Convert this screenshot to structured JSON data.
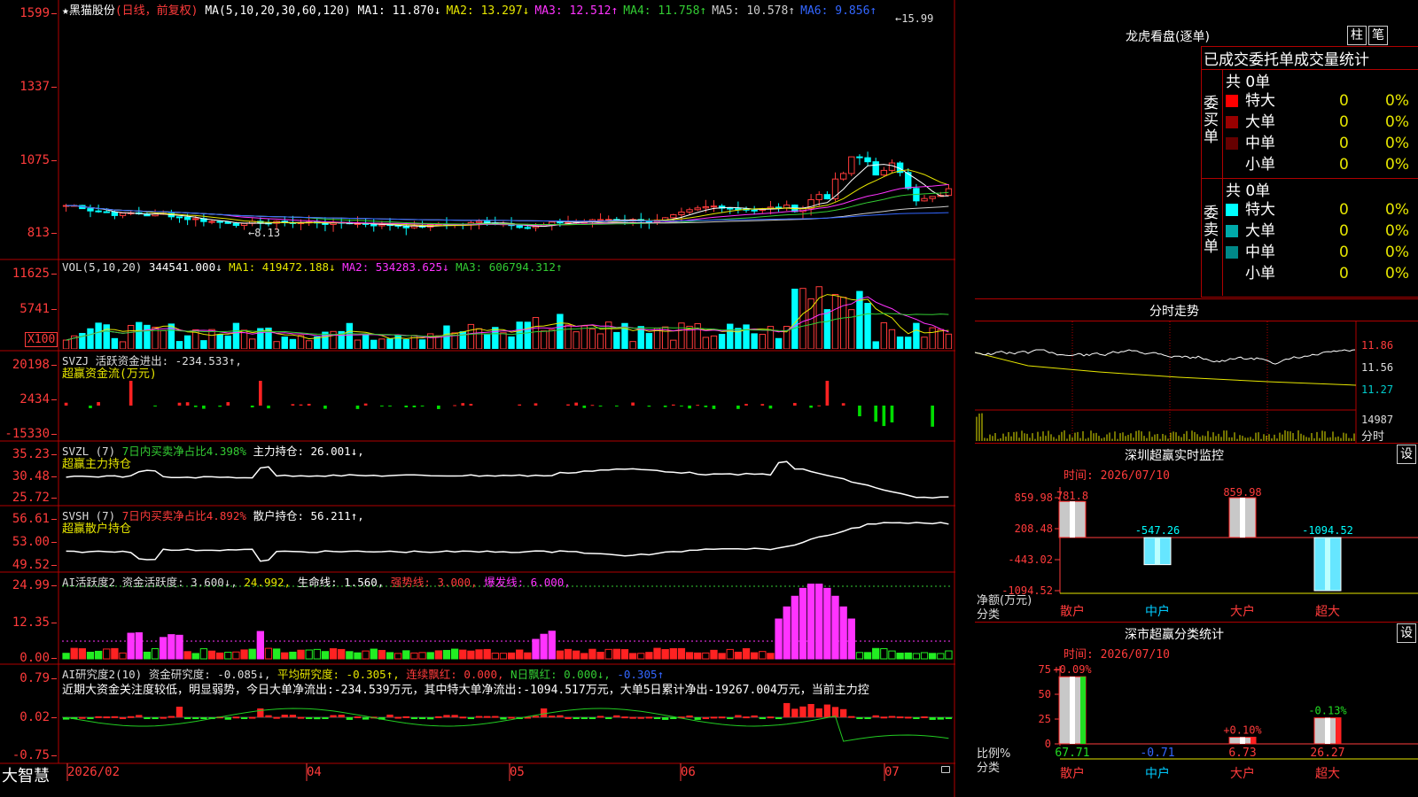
{
  "main_header": {
    "star": "★",
    "stock_name": "黑猫股份",
    "period": "(日线，前复权)",
    "ma_label": "MA(5,10,20,30,60,120)",
    "ma": [
      {
        "label": "MA1:",
        "value": "11.870↓",
        "color": "#ffffff"
      },
      {
        "label": "MA2:",
        "value": "13.297↓",
        "color": "#e6e600"
      },
      {
        "label": "MA3:",
        "value": "12.512↑",
        "color": "#ff33ff"
      },
      {
        "label": "MA4:",
        "value": "11.758↑",
        "color": "#33cc33"
      },
      {
        "label": "MA5:",
        "value": "10.578↑",
        "color": "#cccccc"
      },
      {
        "label": "MA6:",
        "value": "9.856↑",
        "color": "#3366ff"
      }
    ],
    "high_mark": "15.99",
    "low_mark": "8.13",
    "y_ticks": [
      "1599",
      "1337",
      "1075",
      "813"
    ]
  },
  "vol": {
    "header_label": "VOL(5,10,20)",
    "value": "344541.000↓",
    "ma1": "MA1: 419472.188↓",
    "ma2": "MA2: 534283.625↓",
    "ma3": "MA3: 606794.312↑",
    "y_ticks": [
      "11625",
      "5741"
    ],
    "unit": "X100"
  },
  "svzj": {
    "header": "SVZJ  活跃资金进出: -234.533↑,",
    "sub": "超赢资金流(万元)",
    "y_ticks": [
      "20198",
      "2434",
      "-15330"
    ]
  },
  "svzl": {
    "header_a": "SVZL (7)",
    "header_b": "7日内买卖净占比4.398%",
    "header_c": "主力持仓: 26.001↓,",
    "sub": "超赢主力持仓",
    "y_ticks": [
      "35.23",
      "30.48",
      "25.72"
    ]
  },
  "svsh": {
    "header_a": "SVSH (7)",
    "header_b": "7日内买卖净占比4.892%",
    "header_c": "散户持仓: 56.211↑,",
    "sub": "超赢散户持仓",
    "y_ticks": [
      "56.61",
      "53.00",
      "49.52"
    ]
  },
  "ai_active": {
    "header_a": "AI活跃度2 资金活跃度: 3.600↓,",
    "header_b": "24.992,",
    "header_c": "生命线: 1.560,",
    "header_d": "强势线: 3.000,",
    "header_e": "爆发线: 6.000,",
    "y_ticks": [
      "24.99",
      "12.35",
      "0.00"
    ]
  },
  "ai_research": {
    "header_a": "AI研究度2(10) 资金研究度: -0.085↓,",
    "header_b": "平均研究度: -0.305↑,",
    "header_c": "连续飘红: 0.000,",
    "header_d": "N日飘红: 0.000↓,",
    "header_e": "-0.305↑",
    "commentary": "近期大资金关注度较低，明显弱势，今日大单净流出:-234.539万元，其中特大单净流出:-1094.517万元，大单5日累计净出-19267.004万元，当前主力控",
    "y_ticks": [
      "0.79",
      "0.02",
      "-0.75"
    ]
  },
  "x_axis": {
    "brand": "大智慧",
    "labels": [
      "2026/02",
      "04",
      "05",
      "06",
      "07"
    ]
  },
  "lhkp": {
    "title": "龙虎看盘(逐单)",
    "btn_bar": "柱",
    "btn_pen": "笔",
    "subtitle": "已成交委托单成交量统计",
    "buy_label": "委买单",
    "sell_label": "委卖单",
    "buy_total": "共 0单",
    "sell_total": "共 0单",
    "buy_rows": [
      {
        "name": "特大",
        "count": "0",
        "pct": "0%",
        "color": "#ff0000"
      },
      {
        "name": "大单",
        "count": "0",
        "pct": "0%",
        "color": "#990000"
      },
      {
        "name": "中单",
        "count": "0",
        "pct": "0%",
        "color": "#660000"
      },
      {
        "name": "小单",
        "count": "0",
        "pct": "0%",
        "color": ""
      }
    ],
    "sell_rows": [
      {
        "name": "特大",
        "count": "0",
        "pct": "0%",
        "color": "#00ffff"
      },
      {
        "name": "大单",
        "count": "0",
        "pct": "0%",
        "color": "#00aaaa"
      },
      {
        "name": "中单",
        "count": "0",
        "pct": "0%",
        "color": "#008888"
      },
      {
        "name": "小单",
        "count": "0",
        "pct": "0%",
        "color": ""
      }
    ]
  },
  "intraday": {
    "title": "分时走势",
    "prices": [
      "11.86",
      "11.56",
      "11.27"
    ],
    "volume": "14987",
    "vol_label": "分时"
  },
  "sz_monitor": {
    "title": "深圳超赢实时监控",
    "btn": "设",
    "time": "时间: 2026/07/10",
    "y_ticks": [
      "859.98",
      "208.48",
      "-443.02",
      "-1094.52"
    ],
    "y_label": "净额(万元)",
    "x_label": "分类",
    "categories": [
      "散户",
      "中户",
      "大户",
      "超大"
    ],
    "values": [
      "781.8",
      "-547.26",
      "859.98",
      "-1094.52"
    ]
  },
  "sz_class": {
    "title": "深市超赢分类统计",
    "btn": "设",
    "time": "时间: 2026/07/10",
    "y_ticks": [
      "75",
      "50",
      "25",
      "0"
    ],
    "y_label": "比例%",
    "x_label": "分类",
    "categories": [
      "散户",
      "中户",
      "大户",
      "超大"
    ],
    "bar_labels": [
      "+0.09%",
      "",
      "+0.10%",
      "-0.13%"
    ],
    "values": [
      "67.71",
      "-0.71",
      "6.73",
      "26.27"
    ]
  }
}
